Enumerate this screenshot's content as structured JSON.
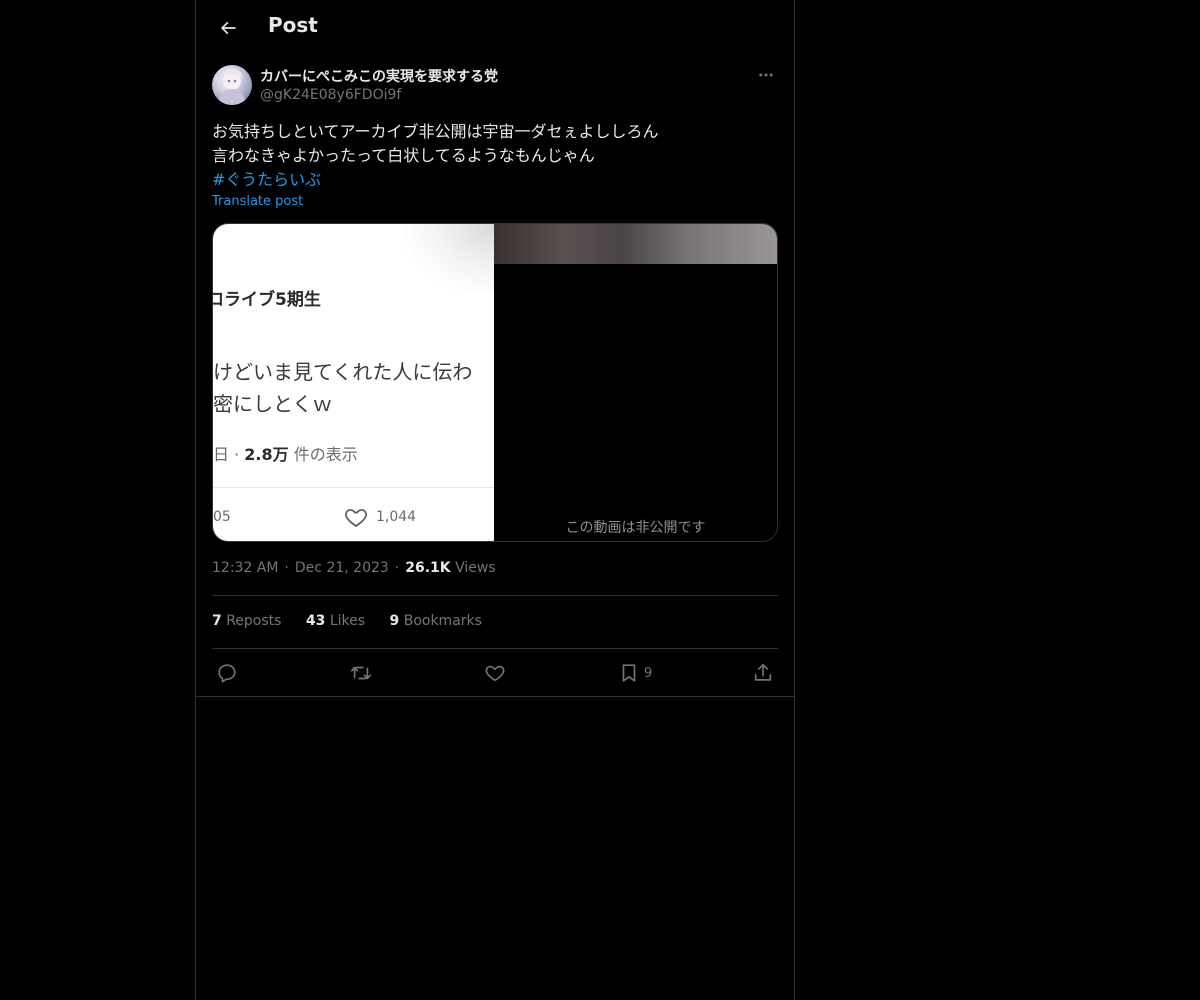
{
  "header": {
    "title": "Post",
    "back_icon": "arrow-left-icon"
  },
  "post": {
    "author": {
      "display_name": "カバーにぺこみこの実現を要求する党",
      "handle": "@gK24E08y6FDOi9f"
    },
    "text_lines": [
      "お気持ちしといてアーカイブ非公開は宇宙一ダセぇよししろん",
      "言わなきゃよかったって白状してるようなもんじゃん"
    ],
    "hashtag": "#ぐうたらいぶ",
    "translate_label": "Translate post",
    "media": {
      "screenshot": {
        "name": "ロライブ5期生",
        "line1": "けどいま見てくれた人に伝わ",
        "line2": "密にしとくｗ",
        "views_prefix": "日 · ",
        "views_count": "2.8万",
        "views_suffix": " 件の表示",
        "left_count": "05",
        "likes": "1,044"
      },
      "video_notice": "この動画は非公開です"
    },
    "meta": {
      "time": "12:32 AM",
      "date": "Dec 21, 2023",
      "views_count": "26.1K",
      "views_label": "Views",
      "separator": "·"
    },
    "stats": {
      "reposts_count": "7",
      "reposts_label": "Reposts",
      "likes_count": "43",
      "likes_label": "Likes",
      "bookmarks_count": "9",
      "bookmarks_label": "Bookmarks"
    },
    "actions": {
      "bookmark_count": "9"
    }
  },
  "colors": {
    "background": "#000000",
    "text": "#e7e9ea",
    "secondary_text": "#71767b",
    "link": "#1d9bf0",
    "border": "#2f3336"
  }
}
